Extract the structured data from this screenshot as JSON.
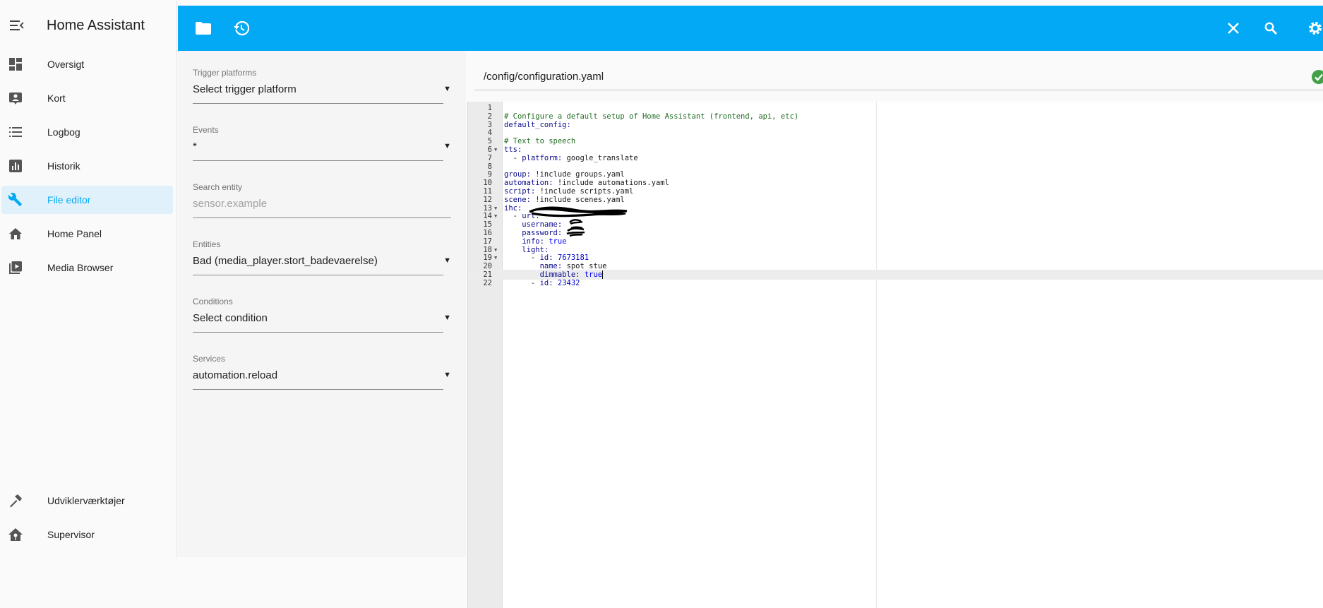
{
  "app": {
    "title": "Home Assistant"
  },
  "sidebar": {
    "items": [
      {
        "label": "Oversigt",
        "icon": "dashboard-icon"
      },
      {
        "label": "Kort",
        "icon": "map-icon"
      },
      {
        "label": "Logbog",
        "icon": "logbook-icon"
      },
      {
        "label": "Historik",
        "icon": "history-chart-icon"
      },
      {
        "label": "File editor",
        "icon": "wrench-icon",
        "active": true
      },
      {
        "label": "Home Panel",
        "icon": "home-icon"
      },
      {
        "label": "Media Browser",
        "icon": "media-play-icon"
      }
    ],
    "bottom_items": [
      {
        "label": "Udviklerværktøjer",
        "icon": "hammer-icon"
      },
      {
        "label": "Supervisor",
        "icon": "supervisor-home-icon"
      }
    ]
  },
  "toolbar": {
    "icons": [
      "folder-icon",
      "history-icon",
      "close-icon",
      "search-icon",
      "settings-icon"
    ]
  },
  "controls": {
    "trigger_platforms": {
      "label": "Trigger platforms",
      "value": "Select trigger platform"
    },
    "events": {
      "label": "Events",
      "value": "*"
    },
    "search_entity": {
      "label": "Search entity",
      "placeholder": "sensor.example"
    },
    "entities": {
      "label": "Entities",
      "value": "Bad (media_player.stort_badevaerelse)"
    },
    "conditions": {
      "label": "Conditions",
      "value": "Select condition"
    },
    "services": {
      "label": "Services",
      "value": "automation.reload"
    }
  },
  "editor": {
    "path": "/config/configuration.yaml",
    "status_icon": "check-circle-icon",
    "active_line": 21,
    "lines": [
      {
        "n": "1",
        "text": ""
      },
      {
        "n": "2",
        "text": "# Configure a default setup of Home Assistant (frontend, api, etc)"
      },
      {
        "n": "3",
        "text": "default_config:"
      },
      {
        "n": "4",
        "text": ""
      },
      {
        "n": "5",
        "text": "# Text to speech"
      },
      {
        "n": "6",
        "text": "tts:",
        "fold": true
      },
      {
        "n": "7",
        "text": "  - platform: google_translate"
      },
      {
        "n": "8",
        "text": ""
      },
      {
        "n": "9",
        "text": "group: !include groups.yaml"
      },
      {
        "n": "10",
        "text": "automation: !include automations.yaml"
      },
      {
        "n": "11",
        "text": "script: !include scripts.yaml"
      },
      {
        "n": "12",
        "text": "scene: !include scenes.yaml"
      },
      {
        "n": "13",
        "text": "ihc:",
        "fold": true
      },
      {
        "n": "14",
        "text": "  - url:",
        "fold": true
      },
      {
        "n": "15",
        "text": "    username:"
      },
      {
        "n": "16",
        "text": "    password:"
      },
      {
        "n": "17",
        "text": "    info: true"
      },
      {
        "n": "18",
        "text": "    light:",
        "fold": true
      },
      {
        "n": "19",
        "text": "      - id: 7673181",
        "fold": true
      },
      {
        "n": "20",
        "text": "        name: spot stue"
      },
      {
        "n": "21",
        "text": "        dimmable: true"
      },
      {
        "n": "22",
        "text": "      - id: 23432"
      }
    ]
  }
}
